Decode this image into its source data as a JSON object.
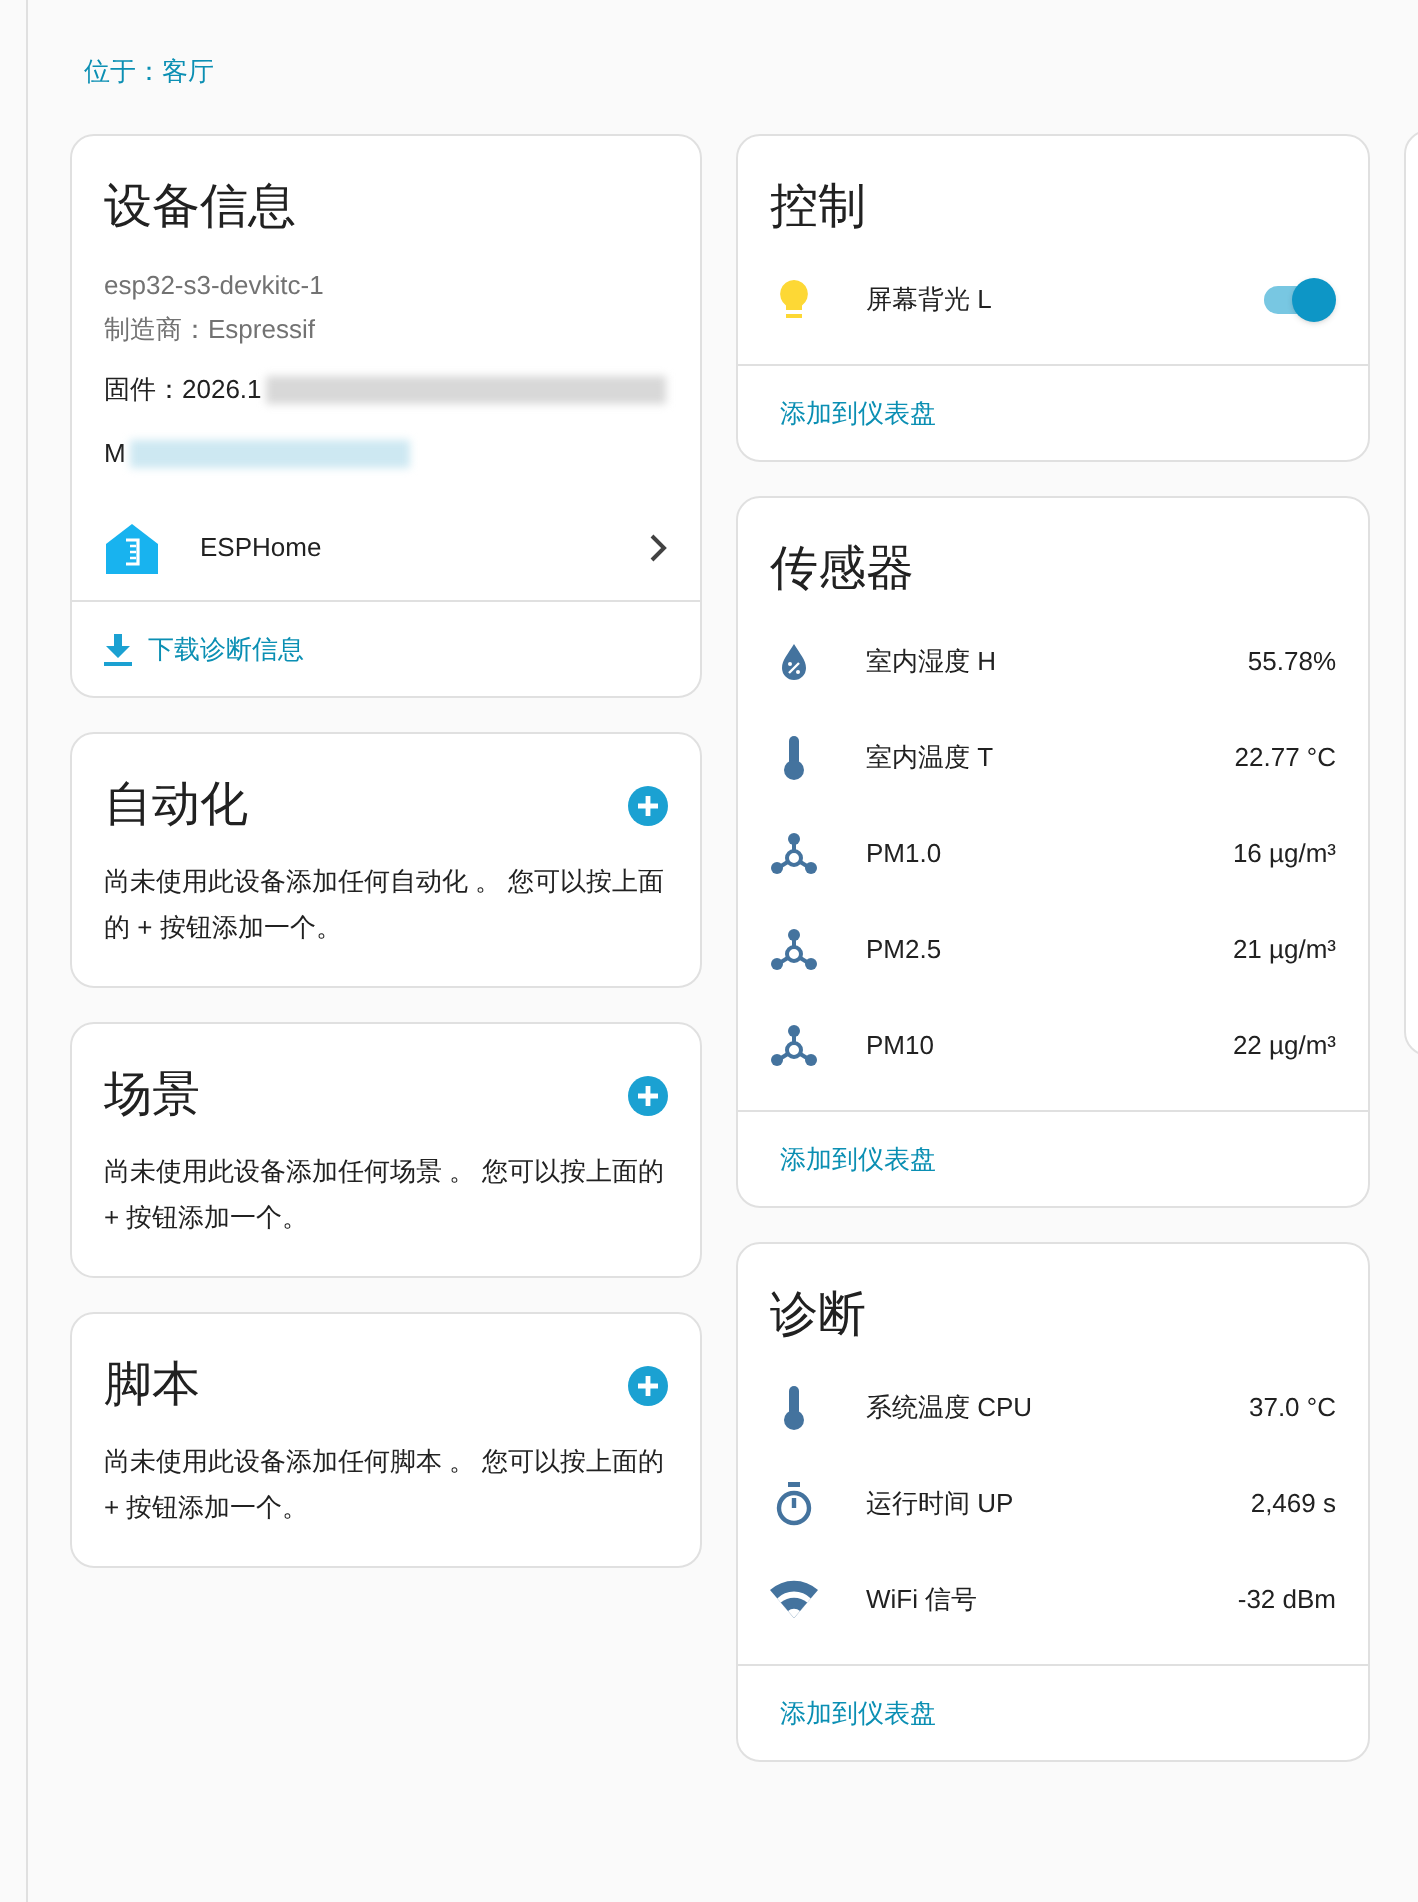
{
  "location": "位于：客厅",
  "device_info": {
    "title": "设备信息",
    "model": "esp32-s3-devkitc-1",
    "manufacturer": "制造商：Espressif",
    "firmware": "固件：2026.1",
    "mac": "M",
    "integration": "ESPHome",
    "download": "下载诊断信息"
  },
  "left_cards": [
    {
      "title": "自动化",
      "text": "尚未使用此设备添加任何自动化 。 您可以按上面的 + 按钮添加一个。"
    },
    {
      "title": "场景",
      "text": "尚未使用此设备添加任何场景 。 您可以按上面的 + 按钮添加一个。"
    },
    {
      "title": "脚本",
      "text": "尚未使用此设备添加任何脚本 。 您可以按上面的 + 按钮添加一个。"
    }
  ],
  "entity_cards": [
    {
      "title": "控制",
      "footer": "添加到仪表盘",
      "rows": [
        {
          "kind": "light",
          "name": "屏幕背光 L",
          "on": true
        }
      ]
    },
    {
      "title": "传感器",
      "footer": "添加到仪表盘",
      "rows": [
        {
          "kind": "humidity",
          "name": "室内湿度 H",
          "value": "55.78%"
        },
        {
          "kind": "temperature",
          "name": "室内温度 T",
          "value": "22.77 °C"
        },
        {
          "kind": "particulate",
          "name": "PM1.0",
          "value": "16 µg/m³"
        },
        {
          "kind": "particulate",
          "name": "PM2.5",
          "value": "21 µg/m³"
        },
        {
          "kind": "particulate",
          "name": "PM10",
          "value": "22 µg/m³"
        }
      ]
    },
    {
      "title": "诊断",
      "footer": "添加到仪表盘",
      "rows": [
        {
          "kind": "temperature",
          "name": "系统温度 CPU",
          "value": "37.0 °C"
        },
        {
          "kind": "timer",
          "name": "运行时间 UP",
          "value": "2,469 s"
        },
        {
          "kind": "signal",
          "name": "WiFi 信号",
          "value": "-32 dBm"
        }
      ]
    }
  ]
}
